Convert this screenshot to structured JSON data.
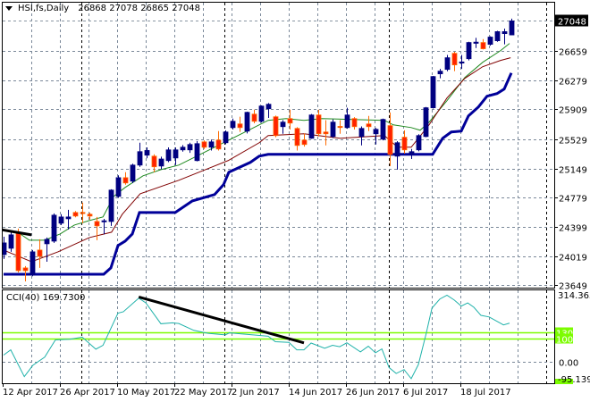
{
  "header": {
    "symbol_label": "HSI,fs,Daily",
    "ohlc": "26868 27078 26865 27048"
  },
  "chart_data": [
    {
      "type": "candlestick",
      "title": "HSI,fs,Daily",
      "ylim": [
        23614,
        27283
      ],
      "y_ticks": [
        "26659",
        "26279",
        "25909",
        "25529",
        "25149",
        "24779",
        "24399",
        "24019",
        "23649"
      ],
      "last_price": "27048",
      "x_labels": [
        {
          "bar": 0,
          "text": "12 Apr 2017"
        },
        {
          "bar": 8,
          "text": "26 Apr 2017"
        },
        {
          "bar": 16,
          "text": "10 May 2017"
        },
        {
          "bar": 24,
          "text": "22 May 2017"
        },
        {
          "bar": 32,
          "text": "2 Jun 2017"
        },
        {
          "bar": 40,
          "text": "14 Jun 2017"
        },
        {
          "bar": 48,
          "text": "26 Jun 2017"
        },
        {
          "bar": 56,
          "text": "6 Jul 2017"
        },
        {
          "bar": 64,
          "text": "18 Jul 2017"
        }
      ],
      "month_separators_at_bar": [
        11,
        31,
        54,
        76
      ],
      "grid": true,
      "candles_ohlc": [
        [
          24040,
          24270,
          23983,
          24190
        ],
        [
          24121,
          24351,
          24075,
          24294
        ],
        [
          24317,
          24374,
          23810,
          23833
        ],
        [
          23868,
          23891,
          23695,
          23833
        ],
        [
          23776,
          24098,
          23760,
          24075
        ],
        [
          24098,
          24236,
          23868,
          24017
        ],
        [
          24179,
          24259,
          23948,
          24236
        ],
        [
          24213,
          24570,
          24190,
          24547
        ],
        [
          24444,
          24560,
          24420,
          24524
        ],
        [
          24501,
          24616,
          24363,
          24524
        ],
        [
          24582,
          24600,
          24520,
          24536
        ],
        [
          24582,
          24708,
          24444,
          24570
        ],
        [
          24559,
          24580,
          24490,
          24536
        ],
        [
          24466,
          24524,
          24225,
          24409
        ],
        [
          24466,
          24500,
          24300,
          24475
        ],
        [
          24466,
          24880,
          24409,
          24870
        ],
        [
          24789,
          25060,
          24770,
          25030
        ],
        [
          25030,
          25100,
          24940,
          24962
        ],
        [
          24985,
          25210,
          24960,
          25192
        ],
        [
          25192,
          25480,
          25170,
          25365
        ],
        [
          25320,
          25420,
          25280,
          25380
        ],
        [
          25307,
          25330,
          25100,
          25170
        ],
        [
          25180,
          25300,
          25140,
          25270
        ],
        [
          25250,
          25420,
          25230,
          25388
        ],
        [
          25284,
          25420,
          25192,
          25388
        ],
        [
          25388,
          25450,
          25365,
          25422
        ],
        [
          25388,
          25480,
          25350,
          25457
        ],
        [
          25250,
          25500,
          25240,
          25468
        ],
        [
          25491,
          25510,
          25400,
          25422
        ],
        [
          25422,
          25520,
          25380,
          25491
        ],
        [
          25514,
          25630,
          25380,
          25399
        ],
        [
          25480,
          25640,
          25460,
          25618
        ],
        [
          25675,
          25790,
          25650,
          25756
        ],
        [
          25722,
          25815,
          25620,
          25675
        ],
        [
          25629,
          25880,
          25600,
          25871
        ],
        [
          25848,
          25905,
          25730,
          25756
        ],
        [
          25756,
          25960,
          25740,
          25952
        ],
        [
          25918,
          25990,
          25800,
          25975
        ],
        [
          25814,
          25830,
          25550,
          25572
        ],
        [
          25687,
          25770,
          25595,
          25745
        ],
        [
          25791,
          25905,
          25650,
          25733
        ],
        [
          25664,
          25680,
          25380,
          25445
        ],
        [
          25514,
          25600,
          25430,
          25457
        ],
        [
          25537,
          25850,
          25530,
          25837
        ],
        [
          25837,
          25905,
          25560,
          25595
        ],
        [
          25618,
          25770,
          25445,
          25595
        ],
        [
          25560,
          25780,
          25540,
          25745
        ],
        [
          25690,
          25770,
          25595,
          25680
        ],
        [
          25675,
          25930,
          25660,
          25837
        ],
        [
          25791,
          25810,
          25650,
          25687
        ],
        [
          25560,
          25690,
          25445,
          25664
        ],
        [
          25722,
          25825,
          25630,
          25687
        ],
        [
          25595,
          25670,
          25457,
          25652
        ],
        [
          25526,
          25790,
          25510,
          25780
        ],
        [
          25700,
          25870,
          25180,
          25330
        ],
        [
          25307,
          25500,
          25134,
          25480
        ],
        [
          25550,
          25640,
          25340,
          25388
        ],
        [
          25330,
          25400,
          25270,
          25365
        ],
        [
          25388,
          25590,
          25370,
          25572
        ],
        [
          25560,
          25940,
          25550,
          25930
        ],
        [
          25930,
          26340,
          25920,
          26332
        ],
        [
          26367,
          26430,
          26310,
          26401
        ],
        [
          26424,
          26610,
          26400,
          26574
        ],
        [
          26631,
          26650,
          26401,
          26482
        ],
        [
          26510,
          26610,
          26430,
          26520
        ],
        [
          26562,
          26780,
          26540,
          26770
        ],
        [
          26760,
          26830,
          26700,
          26775
        ],
        [
          26770,
          26815,
          26680,
          26690
        ],
        [
          26747,
          26850,
          26730,
          26840
        ],
        [
          26793,
          26920,
          26780,
          26910
        ],
        [
          26885,
          26950,
          26747,
          26910
        ],
        [
          26868,
          27078,
          26865,
          27048
        ]
      ],
      "indicators": [
        {
          "name": "fast-ma",
          "color": "#1f8a1f",
          "points": [
            [
              0,
              24363
            ],
            [
              2,
              24328
            ],
            [
              3.6,
              24225
            ],
            [
              5.75,
              24225
            ],
            [
              7.9,
              24305
            ],
            [
              9.9,
              24420
            ],
            [
              12,
              24478
            ],
            [
              13.9,
              24524
            ],
            [
              15.4,
              24789
            ],
            [
              17,
              24904
            ],
            [
              19.5,
              25054
            ],
            [
              22,
              25134
            ],
            [
              24.5,
              25192
            ],
            [
              27,
              25307
            ],
            [
              30.75,
              25480
            ],
            [
              34.5,
              25652
            ],
            [
              37,
              25768
            ],
            [
              39.5,
              25791
            ],
            [
              42,
              25768
            ],
            [
              44.5,
              25791
            ],
            [
              53.25,
              25768
            ],
            [
              54.5,
              25710
            ],
            [
              57,
              25675
            ],
            [
              58.25,
              25641
            ],
            [
              59.5,
              25745
            ],
            [
              62,
              26021
            ],
            [
              64.5,
              26320
            ],
            [
              67,
              26516
            ],
            [
              69.5,
              26666
            ],
            [
              70.75,
              26758
            ]
          ]
        },
        {
          "name": "slow-ma",
          "color": "#800000",
          "points": [
            [
              0,
              24098
            ],
            [
              3.9,
              23948
            ],
            [
              7.6,
              24075
            ],
            [
              12,
              24259
            ],
            [
              15.1,
              24328
            ],
            [
              16.6,
              24559
            ],
            [
              19.1,
              24823
            ],
            [
              24.5,
              24996
            ],
            [
              28.25,
              25134
            ],
            [
              31.4,
              25250
            ],
            [
              35.75,
              25480
            ],
            [
              37,
              25572
            ],
            [
              42,
              25595
            ],
            [
              47,
              25537
            ],
            [
              53.25,
              25572
            ],
            [
              55.1,
              25422
            ],
            [
              57,
              25422
            ],
            [
              59.5,
              25710
            ],
            [
              62,
              26056
            ],
            [
              64.5,
              26309
            ],
            [
              67,
              26459
            ],
            [
              69.5,
              26540
            ],
            [
              70.9,
              26574
            ]
          ]
        },
        {
          "name": "channel-line",
          "color": "#000099",
          "points": [
            [
              0,
              23787
            ],
            [
              14,
              23787
            ],
            [
              15,
              23868
            ],
            [
              16,
              24156
            ],
            [
              17,
              24213
            ],
            [
              18,
              24305
            ],
            [
              19,
              24582
            ],
            [
              24,
              24582
            ],
            [
              26.4,
              24731
            ],
            [
              29.5,
              24812
            ],
            [
              30.75,
              24939
            ],
            [
              31.5,
              25100
            ],
            [
              34.5,
              25227
            ],
            [
              35.75,
              25307
            ],
            [
              37,
              25330
            ],
            [
              60,
              25330
            ],
            [
              61.4,
              25537
            ],
            [
              62.6,
              25618
            ],
            [
              64,
              25630
            ],
            [
              65,
              25825
            ],
            [
              66.4,
              25941
            ],
            [
              67.6,
              26079
            ],
            [
              69,
              26113
            ],
            [
              70,
              26171
            ],
            [
              71,
              26378
            ]
          ]
        }
      ],
      "trendline": [
        [
          -0.5,
          24363
        ],
        [
          3.9,
          24294
        ]
      ],
      "colors": {
        "bull": "#000080",
        "bear": "#ff2200",
        "bear_edge": "#ff6a00",
        "grid": "#7a8899",
        "separator": "#000000",
        "trendline": "#000000"
      }
    },
    {
      "type": "line",
      "title": "CCI(40) 169.7300",
      "ylim": [
        -95.1391,
        314.3633
      ],
      "y_tick_labels": {
        "max": "314.3633",
        "min": "-95.1391",
        "zero": "0.00"
      },
      "levels": [
        {
          "value": 130,
          "label": "130"
        },
        {
          "value": 100,
          "label": "100"
        }
      ],
      "series": [
        {
          "name": "CCI(40)",
          "color": "#20b2aa",
          "points": [
            [
              0,
              29
            ],
            [
              1,
              52
            ],
            [
              2.9,
              -66
            ],
            [
              4.1,
              -16
            ],
            [
              5.75,
              20
            ],
            [
              7.25,
              96
            ],
            [
              9.25,
              99
            ],
            [
              11,
              108
            ],
            [
              12.9,
              55
            ],
            [
              13.9,
              72
            ],
            [
              16,
              214
            ],
            [
              16.75,
              220
            ],
            [
              18.9,
              280
            ],
            [
              19.9,
              259
            ],
            [
              22,
              167
            ],
            [
              23.6,
              171
            ],
            [
              24.5,
              168
            ],
            [
              26.6,
              138
            ],
            [
              28.6,
              125
            ],
            [
              31,
              118
            ],
            [
              31.6,
              127
            ],
            [
              34.9,
              118
            ],
            [
              37,
              112
            ],
            [
              38,
              88
            ],
            [
              39.9,
              85
            ],
            [
              41,
              52
            ],
            [
              42,
              52
            ],
            [
              43,
              82
            ],
            [
              44.9,
              59
            ],
            [
              46,
              72
            ],
            [
              47,
              66
            ],
            [
              48,
              83
            ],
            [
              49.9,
              43
            ],
            [
              51,
              68
            ],
            [
              52,
              39
            ],
            [
              52.9,
              56
            ],
            [
              53.9,
              -26
            ],
            [
              54.9,
              -52
            ],
            [
              56,
              -35
            ],
            [
              57,
              -75
            ],
            [
              58,
              -13
            ],
            [
              59.1,
              125
            ],
            [
              59.9,
              236
            ],
            [
              61,
              276
            ],
            [
              62,
              293
            ],
            [
              63,
              272
            ],
            [
              64,
              245
            ],
            [
              64.9,
              259
            ],
            [
              65.75,
              240
            ],
            [
              66.75,
              204
            ],
            [
              67.9,
              197
            ],
            [
              69.9,
              162
            ],
            [
              70.75,
              169.73
            ]
          ]
        }
      ],
      "trendline": [
        [
          18.9,
          285
        ],
        [
          42,
          83
        ]
      ],
      "colors": {
        "level": "#7cfc00",
        "grid": "#7a8899"
      }
    }
  ]
}
